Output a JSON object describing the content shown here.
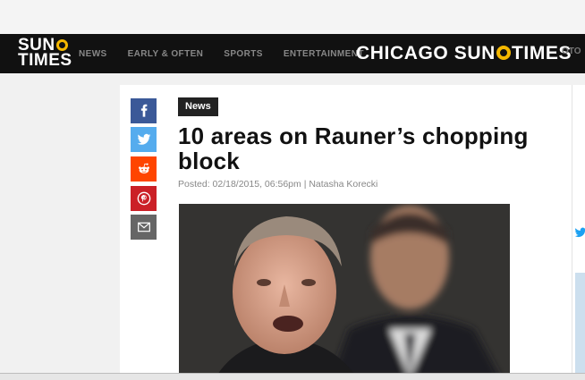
{
  "nav": {
    "logo_line1": "SUN",
    "logo_line2": "TIMES",
    "links": [
      "NEWS",
      "EARLY & OFTEN",
      "SPORTS",
      "ENTERTAINMENT"
    ],
    "brand_a": "CHICAGO SUN",
    "brand_b": "TIMES",
    "more": "OTO"
  },
  "share": [
    "facebook-icon",
    "twitter-icon",
    "reddit-icon",
    "pinterest-icon",
    "email-icon"
  ],
  "article": {
    "category": "News",
    "title": "10 areas on Rauner’s chopping block",
    "byline": "Posted: 02/18/2015, 06:56pm | Natasha Korecki"
  },
  "colors": {
    "nav_bg": "#111111",
    "accent": "#f5b800",
    "facebook": "#3b5998",
    "twitter": "#55acee",
    "reddit": "#ff4500",
    "pinterest": "#cb2027",
    "email": "#666666"
  }
}
